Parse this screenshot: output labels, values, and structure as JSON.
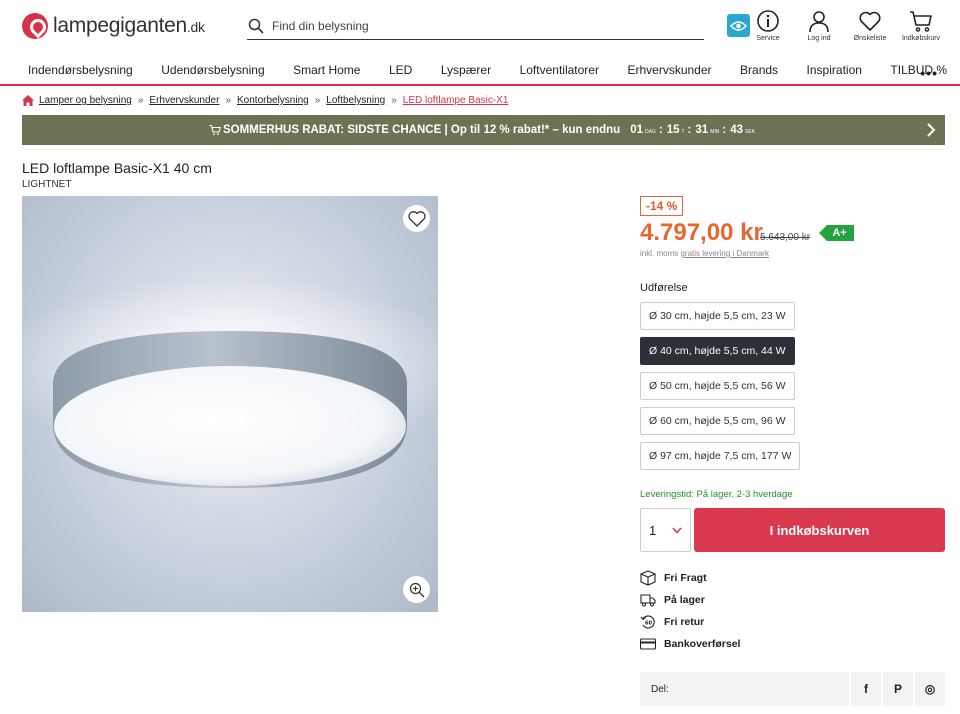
{
  "header": {
    "logo_text": "lampegiganten",
    "logo_tld": ".dk",
    "search_placeholder": "Find din belysning",
    "icons": [
      {
        "name": "service-icon",
        "label": "Service"
      },
      {
        "name": "user-icon",
        "label": "Log ind"
      },
      {
        "name": "heart-icon",
        "label": "Ønskeliste"
      },
      {
        "name": "cart-icon",
        "label": "Indkøbskurv"
      }
    ]
  },
  "nav": {
    "items": [
      "Indendørsbelysning",
      "Udendørsbelysning",
      "Smart Home",
      "LED",
      "Lyspærer",
      "Loftventilatorer",
      "Erhvervskunder",
      "Brands",
      "Inspiration",
      "TILBUD %"
    ],
    "more": "•••"
  },
  "breadcrumb": {
    "items": [
      "Lamper og belysning",
      "Erhvervskunder",
      "Kontorbelysning",
      "Loftbelysning"
    ],
    "current": "LED loftlampe Basic-X1",
    "separator": "»"
  },
  "promo": {
    "text": "SOMMERHUS RABAT: SIDSTE CHANCE | Op til 12 % rabat!* – kun endnu",
    "countdown": [
      {
        "value": "01",
        "unit": "DAG"
      },
      {
        "value": "15",
        "unit": "T"
      },
      {
        "value": "31",
        "unit": "MIN"
      },
      {
        "value": "43",
        "unit": "SEK"
      }
    ]
  },
  "product": {
    "title": "LED loftlampe Basic-X1 40 cm",
    "brand": "LIGHTNET",
    "discount": "-14 %",
    "price": "4.797,00 kr",
    "old_price": "5.643,00 kr",
    "energy_class": "A+",
    "vat_prefix": "inkl. moms",
    "vat_link": "gratis levering i Danmark",
    "variant_label": "Udførelse",
    "variants": [
      {
        "label": "Ø 30 cm, højde 5,5 cm, 23 W",
        "selected": false
      },
      {
        "label": "Ø 40 cm, højde 5,5 cm, 44 W",
        "selected": true
      },
      {
        "label": "Ø 50 cm, højde 5,5 cm, 56 W",
        "selected": false
      },
      {
        "label": "Ø 60 cm, højde 5,5 cm, 96 W",
        "selected": false
      },
      {
        "label": "Ø 97 cm, højde 7,5 cm, 177 W",
        "selected": false
      }
    ],
    "delivery": "Leveringstid: På lager. 2-3 hverdage",
    "quantity": "1",
    "add_to_cart": "I indkøbskurven",
    "usps": [
      {
        "icon": "box-icon",
        "label": "Fri Fragt"
      },
      {
        "icon": "truck-icon",
        "label": "På lager"
      },
      {
        "icon": "return-icon",
        "label": "Fri retur"
      },
      {
        "icon": "card-icon",
        "label": "Bankoverførsel"
      }
    ],
    "share_label": "Del:",
    "share_icons": [
      {
        "name": "facebook-icon",
        "glyph": "f"
      },
      {
        "name": "pinterest-icon",
        "glyph": "P"
      },
      {
        "name": "instagram-icon",
        "glyph": "◎"
      }
    ]
  },
  "colors": {
    "brand_red": "#d6334b",
    "price_orange": "#e8662f",
    "promo_bg": "#6e7254",
    "energy_green": "#24a33e",
    "delivery_green": "#2e8b2e"
  }
}
